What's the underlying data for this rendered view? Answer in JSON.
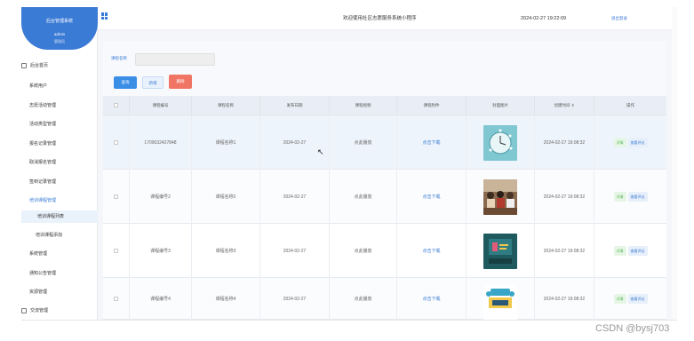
{
  "brand": {
    "system_name": "后台管理系统",
    "user": "admin",
    "role": "管理员"
  },
  "menu": [
    {
      "label": "后台首页"
    },
    {
      "label": "系统用户"
    },
    {
      "label": "志愿活动管理"
    },
    {
      "label": "活动类型管理"
    },
    {
      "label": "报名记录管理"
    },
    {
      "label": "取消报名管理"
    },
    {
      "label": "签到记录管理"
    },
    {
      "label": "培训课程管理"
    },
    {
      "label": "培训课程列表"
    },
    {
      "label": "培训课程添加"
    },
    {
      "label": "系统管理"
    },
    {
      "label": "通知公告管理"
    },
    {
      "label": "资源管理"
    },
    {
      "label": "交流管理"
    }
  ],
  "header": {
    "title": "欢迎使用社区志愿服务系统小程序",
    "datetime": "2024-02-27 19:22:09",
    "exit": "退出登录"
  },
  "search": {
    "label": "课程名称",
    "placeholder": "",
    "value": ""
  },
  "buttons": {
    "query": "查询",
    "add": "新增",
    "delete": "删除"
  },
  "table": {
    "headers": [
      "课程编号",
      "课程名称",
      "发布日期",
      "课程视频",
      "课程附件",
      "封面图片",
      "创建时间 ⇕",
      "操作"
    ],
    "rows": [
      {
        "code": "1709032427848",
        "name": "课程名称1",
        "date": "2024-02-27",
        "video": "点此播放",
        "file": "点击下载",
        "created": "2024-02-27 19:08:32"
      },
      {
        "code": "课程编号2",
        "name": "课程名称2",
        "date": "2024-02-27",
        "video": "点此播放",
        "file": "点击下载",
        "created": "2024-02-27 19:08:32"
      },
      {
        "code": "课程编号3",
        "name": "课程名称3",
        "date": "2024-02-27",
        "video": "点此播放",
        "file": "点击下载",
        "created": "2024-02-27 19:08:32"
      },
      {
        "code": "课程编号4",
        "name": "课程名称4",
        "date": "2024-02-27",
        "video": "点此播放",
        "file": "点击下载",
        "created": "2024-02-27 19:08:32"
      }
    ],
    "ops": {
      "edit": "详情",
      "view": "查看评论"
    }
  },
  "watermark": "CSDN @bysj703",
  "colors": {
    "accent": "#3a7bd5",
    "danger": "#f07565",
    "success": "#5fb85f"
  }
}
